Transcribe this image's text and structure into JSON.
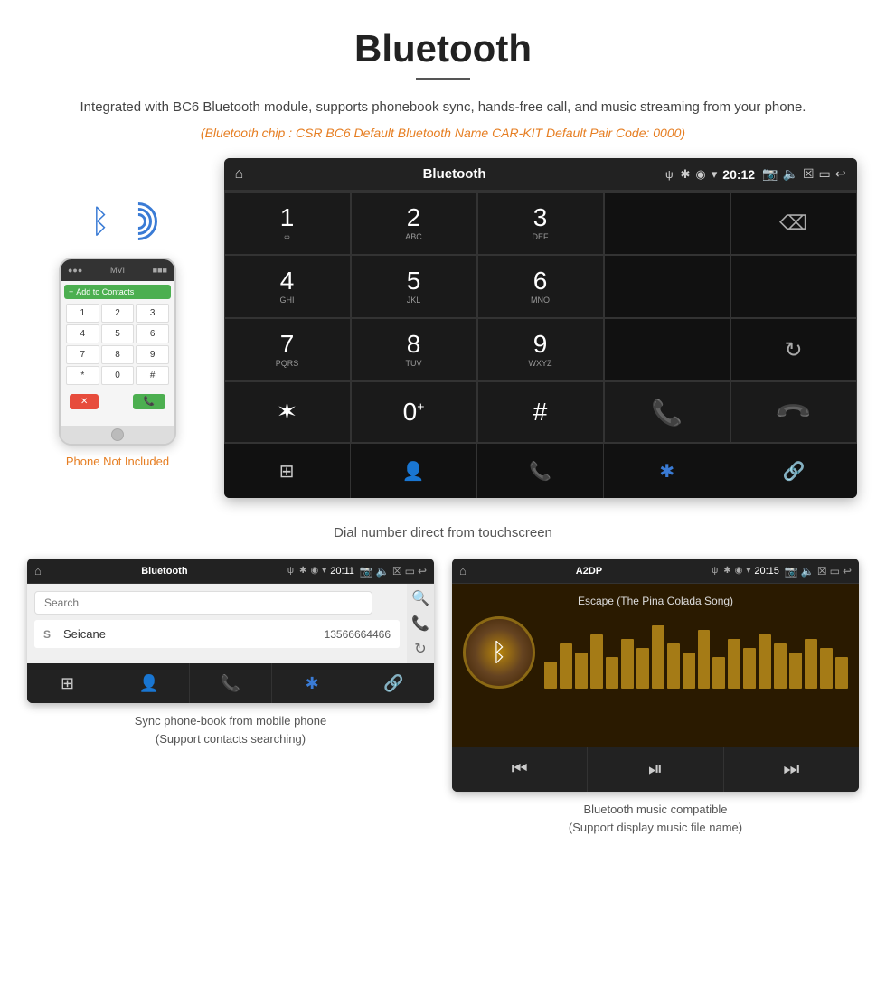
{
  "header": {
    "title": "Bluetooth",
    "description": "Integrated with BC6 Bluetooth module, supports phonebook sync, hands-free call, and music streaming from your phone.",
    "specs": "(Bluetooth chip : CSR BC6    Default Bluetooth Name CAR-KIT    Default Pair Code: 0000)"
  },
  "main_screen": {
    "status_title": "Bluetooth",
    "status_time": "20:12",
    "status_usb": "ψ",
    "keys": [
      {
        "num": "1",
        "letters": "∞"
      },
      {
        "num": "2",
        "letters": "ABC"
      },
      {
        "num": "3",
        "letters": "DEF"
      },
      {
        "num": "",
        "letters": ""
      },
      {
        "num": "",
        "letters": "⌫"
      },
      {
        "num": "4",
        "letters": "GHI"
      },
      {
        "num": "5",
        "letters": "JKL"
      },
      {
        "num": "6",
        "letters": "MNO"
      },
      {
        "num": "",
        "letters": ""
      },
      {
        "num": "",
        "letters": ""
      },
      {
        "num": "7",
        "letters": "PQRS"
      },
      {
        "num": "8",
        "letters": "TUV"
      },
      {
        "num": "9",
        "letters": "WXYZ"
      },
      {
        "num": "",
        "letters": ""
      },
      {
        "num": "",
        "letters": "↻"
      },
      {
        "num": "*",
        "letters": ""
      },
      {
        "num": "0",
        "letters": "+"
      },
      {
        "num": "#",
        "letters": ""
      },
      {
        "num": "",
        "letters": "📞"
      },
      {
        "num": "",
        "letters": "📞-end"
      }
    ],
    "bottom_icons": [
      "⊞",
      "👤",
      "📞",
      "✱",
      "🔗"
    ]
  },
  "dial_caption": "Dial number direct from touchscreen",
  "phonebook_screen": {
    "status_title": "Bluetooth",
    "status_time": "20:11",
    "search_placeholder": "Search",
    "contact_letter": "S",
    "contact_name": "Seicane",
    "contact_number": "13566664466",
    "bottom_icons": [
      "⊞",
      "👤",
      "📞",
      "✱",
      "🔗"
    ]
  },
  "phonebook_caption_line1": "Sync phone-book from mobile phone",
  "phonebook_caption_line2": "(Support contacts searching)",
  "music_screen": {
    "status_title": "A2DP",
    "status_time": "20:15",
    "song_title": "Escape (The Pina Colada Song)",
    "bar_heights": [
      30,
      50,
      40,
      60,
      35,
      55,
      45,
      70,
      50,
      40,
      65,
      35,
      55,
      45,
      60,
      50,
      40,
      55,
      45,
      35
    ]
  },
  "music_caption_line1": "Bluetooth music compatible",
  "music_caption_line2": "(Support display music file name)",
  "phone_not_included": "Phone Not Included"
}
